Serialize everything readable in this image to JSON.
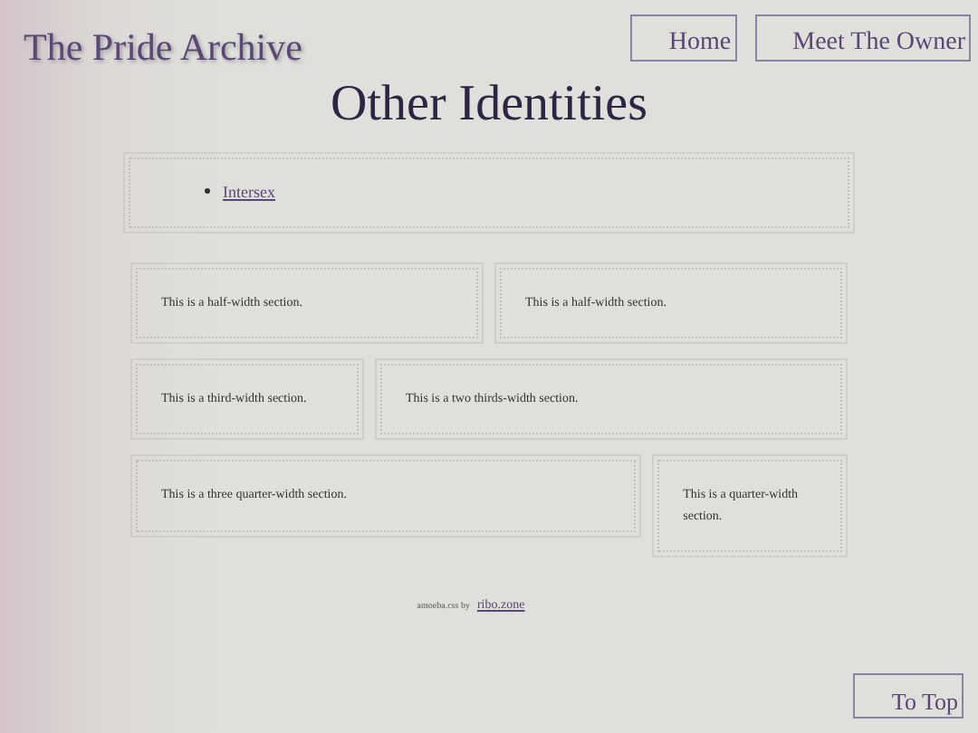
{
  "site_title": "The Pride Archive",
  "nav": [
    "Home",
    "Meet The Owner"
  ],
  "heading": "Other Identities",
  "links": [
    "Intersex"
  ],
  "rows": [
    [
      {
        "kind": "half",
        "text": "This is a half-width section."
      },
      {
        "kind": "half",
        "text": "This is a half-width section."
      }
    ],
    [
      {
        "kind": "third",
        "text": "This is a third-width section."
      },
      {
        "kind": "two-thirds",
        "text": "This is a two thirds-width section."
      }
    ],
    [
      {
        "kind": "three-quarter",
        "text": "This is a three quarter-width section."
      },
      {
        "kind": "quarter",
        "text": "This is a quarter-width section."
      }
    ]
  ],
  "footer": {
    "text": "amoeba.css by",
    "link": "ribo.zone"
  },
  "to_top": "To Top"
}
